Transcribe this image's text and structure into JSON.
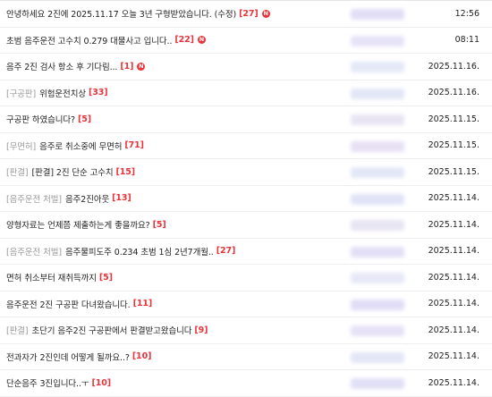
{
  "rows": [
    {
      "prefix": "",
      "subject": "안녕하세요 2진에 2025.11.17 오늘 3년 구형받았습니다. (수정)",
      "count": "[27]",
      "new": true,
      "date": "12:56",
      "author_color": "#c9c3ee"
    },
    {
      "prefix": "",
      "subject": "초범 음주운전 고수치 0.279 대물사고 입니다..",
      "count": "[22]",
      "new": true,
      "date": "08:11",
      "author_color": "#d4cdf2"
    },
    {
      "prefix": "",
      "subject": "음주 2진 검사 항소 후 기다림...",
      "count": "[1]",
      "new": true,
      "date": "2025.11.16.",
      "author_color": "#cfd6f0"
    },
    {
      "prefix": "[구공판]",
      "subject": "위험운전치상",
      "count": "[33]",
      "new": false,
      "date": "2025.11.16.",
      "author_color": "#cbd3ee"
    },
    {
      "prefix": "",
      "subject": "구공판 하였습니다?",
      "count": "[5]",
      "new": false,
      "date": "2025.11.15.",
      "author_color": "#d6cfe9"
    },
    {
      "prefix": "[무면허]",
      "subject": "음주로 취소중에 무면허",
      "count": "[71]",
      "new": false,
      "date": "2025.11.15.",
      "author_color": "#d3c7ec"
    },
    {
      "prefix": "[판결]",
      "subject": "[판결] 2진 단순 고수치",
      "count": "[15]",
      "new": false,
      "date": "2025.11.15.",
      "author_color": "#ccd5ef"
    },
    {
      "prefix": "[음주운전 처벌]",
      "subject": "음주2진아웃",
      "count": "[13]",
      "new": false,
      "date": "2025.11.14.",
      "author_color": "#c7cdf0"
    },
    {
      "prefix": "",
      "subject": "양형자료는 언제쯤 제출하는게 좋을까요?",
      "count": "[5]",
      "new": false,
      "date": "2025.11.14.",
      "author_color": "#d5cfe7"
    },
    {
      "prefix": "[음주운전 처벌]",
      "subject": "음주물피도주 0.234 초범 1심 2년7개월..",
      "count": "[27]",
      "new": false,
      "date": "2025.11.14.",
      "author_color": "#cbc6ef"
    },
    {
      "prefix": "",
      "subject": "면허 취소부터 재취득까지",
      "count": "[5]",
      "new": false,
      "date": "2025.11.14.",
      "author_color": "#d2d6ee"
    },
    {
      "prefix": "",
      "subject": "음주운전 2진 구공판 다녀왔습니다.",
      "count": "[11]",
      "new": false,
      "date": "2025.11.14.",
      "author_color": "#c9c1ee"
    },
    {
      "prefix": "[판결]",
      "subject": "초단기 음주2진 구공판에서 판결받고왔습니다",
      "count": "[9]",
      "new": false,
      "date": "2025.11.14.",
      "author_color": "#d3cbee"
    },
    {
      "prefix": "",
      "subject": "전과자가 2진인데 어떻게 될까요..?",
      "count": "[10]",
      "new": false,
      "date": "2025.11.14.",
      "author_color": "#cdd3ee"
    },
    {
      "prefix": "",
      "subject": "단순음주 3진입니다..ㅜ",
      "count": "[10]",
      "new": false,
      "date": "2025.11.14.",
      "author_color": "#c8c6ee"
    }
  ],
  "icons": {
    "new_badge": "new-badge-icon",
    "new_badge_text": "N"
  },
  "colors": {
    "count": "#e8333a",
    "prefix": "#9a9a9a",
    "text": "#222222",
    "divider": "#eeeeee"
  }
}
